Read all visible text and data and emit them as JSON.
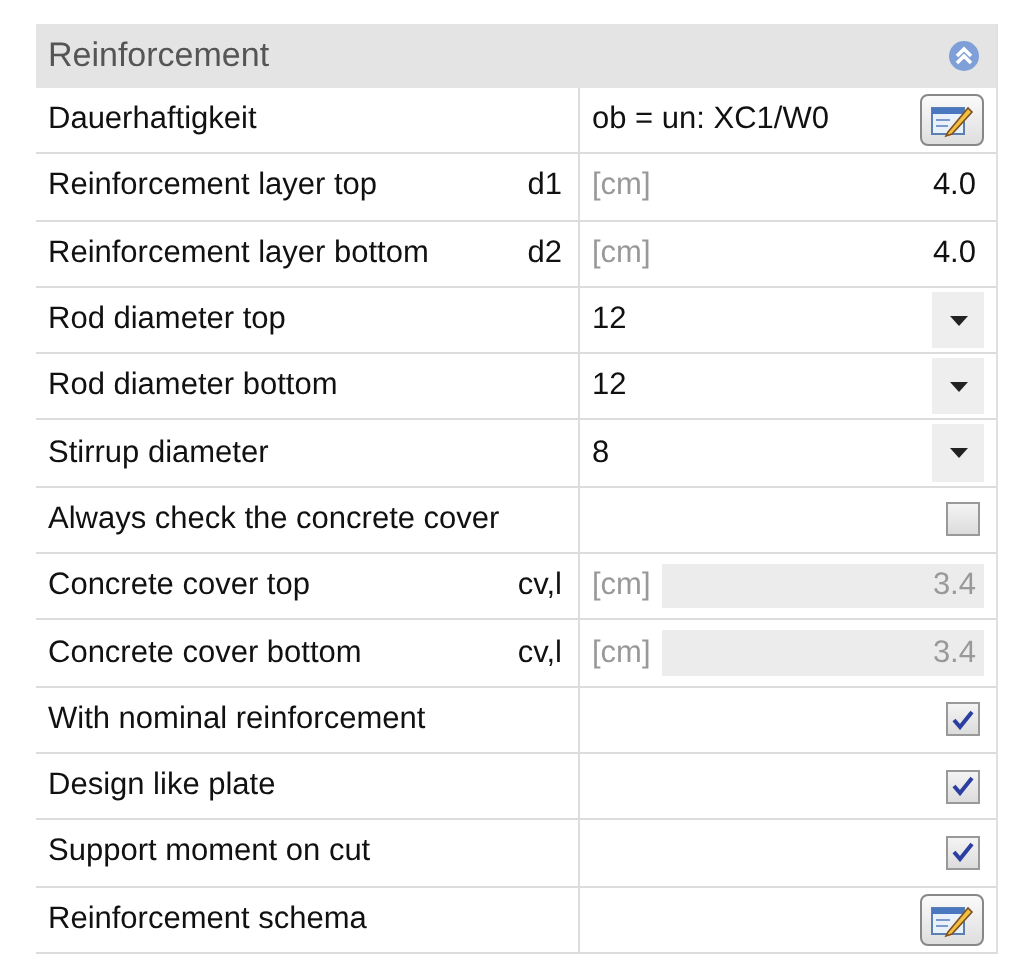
{
  "panel": {
    "title": "Reinforcement",
    "expanded": true
  },
  "rows": [
    {
      "kind": "button",
      "label": "Dauerhaftigkeit",
      "value": "ob = un: XC1/W0"
    },
    {
      "kind": "number",
      "label": "Reinforcement layer top",
      "symbol": "d1",
      "unit": "[cm]",
      "value": "4.0",
      "disabled": false
    },
    {
      "kind": "number",
      "label": "Reinforcement layer bottom",
      "symbol": "d2",
      "unit": "[cm]",
      "value": "4.0",
      "disabled": false
    },
    {
      "kind": "dropdown",
      "label": "Rod diameter top",
      "value": "12"
    },
    {
      "kind": "dropdown",
      "label": "Rod diameter bottom",
      "value": "12"
    },
    {
      "kind": "dropdown",
      "label": "Stirrup diameter",
      "value": "8"
    },
    {
      "kind": "checkbox",
      "label": "Always check the concrete cover",
      "checked": false
    },
    {
      "kind": "number",
      "label": "Concrete cover top",
      "symbol": "cv,l",
      "unit": "[cm]",
      "value": "3.4",
      "disabled": true
    },
    {
      "kind": "number",
      "label": "Concrete cover bottom",
      "symbol": "cv,l",
      "unit": "[cm]",
      "value": "3.4",
      "disabled": true
    },
    {
      "kind": "checkbox",
      "label": "With nominal reinforcement",
      "checked": true
    },
    {
      "kind": "checkbox",
      "label": "Design like plate",
      "checked": true
    },
    {
      "kind": "checkbox",
      "label": "Support moment on cut",
      "checked": true
    },
    {
      "kind": "button",
      "label": "Reinforcement schema"
    }
  ]
}
